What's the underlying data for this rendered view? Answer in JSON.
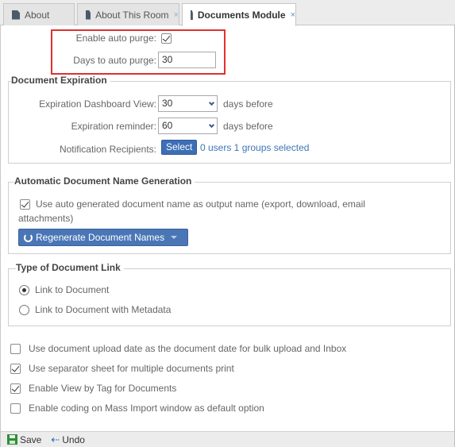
{
  "tabs": [
    {
      "label": "About",
      "closable": false
    },
    {
      "label": "About This Room",
      "closable": true
    },
    {
      "label": "Documents Module",
      "closable": true,
      "active": true
    }
  ],
  "close_glyph": "×",
  "auto_purge": {
    "enable_label": "Enable auto purge:",
    "enabled": true,
    "days_label": "Days to auto purge:",
    "days_value": "30"
  },
  "expiration": {
    "legend": "Document Expiration",
    "dashboard_label": "Expiration Dashboard View:",
    "dashboard_value": "30",
    "dashboard_suffix": "days before",
    "reminder_label": "Expiration reminder:",
    "reminder_value": "60",
    "reminder_suffix": "days before",
    "recipients_label": "Notification Recipients:",
    "select_button": "Select",
    "recipients_summary": "0 users 1 groups selected"
  },
  "name_generation": {
    "legend": "Automatic Document Name Generation",
    "use_auto_line1": "Use auto generated document name as output name (export, download, email",
    "use_auto_line2": "attachments)",
    "use_auto_checked": true,
    "regenerate_button": "Regenerate Document Names"
  },
  "link_type": {
    "legend": "Type of Document Link",
    "options": [
      {
        "label": "Link to Document",
        "selected": true
      },
      {
        "label": "Link to Document with Metadata",
        "selected": false
      }
    ]
  },
  "options": [
    {
      "label": "Use document upload date as the document date for bulk upload and Inbox",
      "checked": false
    },
    {
      "label": "Use separator sheet for multiple documents print",
      "checked": true
    },
    {
      "label": "Enable View by Tag for Documents",
      "checked": true
    },
    {
      "label": "Enable coding on Mass Import window as default option",
      "checked": false
    }
  ],
  "toolbar": {
    "save_label": "Save",
    "undo_label": "Undo"
  },
  "colors": {
    "highlight": "#e03030",
    "primary_button": "#3d6fb5",
    "link": "#3d76b8"
  }
}
